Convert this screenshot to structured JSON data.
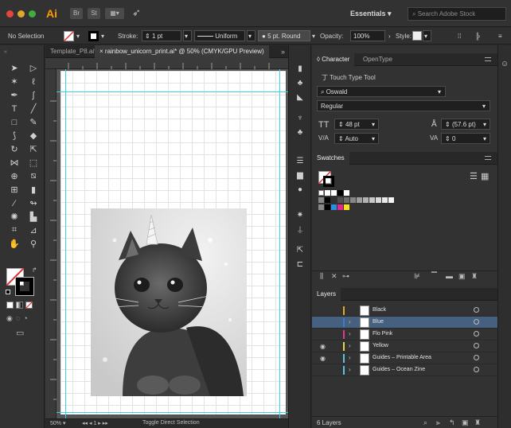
{
  "app": {
    "logo": "Ai",
    "bridge_icon": "Br",
    "stock_icon": "St",
    "workspace": "Essentials",
    "search_placeholder": "Search Adobe Stock"
  },
  "control_bar": {
    "selection": "No Selection",
    "stroke_label": "Stroke:",
    "stroke_value": "1 pt",
    "profile": "Uniform",
    "brush": "5 pt. Round",
    "opacity_label": "Opacity:",
    "opacity_value": "100%",
    "style_label": "Style:"
  },
  "document_tabs": [
    {
      "label": "Template_P8.ai*"
    },
    {
      "label": "rainbow_unicorn_print.ai* @ 50% (CMYK/GPU Preview)"
    }
  ],
  "status": {
    "label": "Toggle Direct Selection"
  },
  "character_panel": {
    "tab_character": "Character",
    "tab_opentype": "OpenType",
    "touch_type": "Touch Type Tool",
    "font_family": "Oswald",
    "font_style": "Regular",
    "font_size": "48 pt",
    "leading": "(57.6 pt)",
    "kerning": "Auto",
    "tracking": "0"
  },
  "swatches_panel": {
    "title": "Swatches"
  },
  "layers_panel": {
    "title": "Layers",
    "count": "6 Layers",
    "layers": [
      {
        "name": "Black",
        "color": "#e0a82e",
        "selected": false,
        "visible": false
      },
      {
        "name": "Blue",
        "color": "#3d7bd6",
        "selected": true,
        "visible": false
      },
      {
        "name": "Flo Pink",
        "color": "#e33b8c",
        "selected": false,
        "visible": false
      },
      {
        "name": "Yellow",
        "color": "#e6d640",
        "selected": false,
        "visible": true
      },
      {
        "name": "Guides – Printable Area",
        "color": "#54c7e8",
        "selected": false,
        "visible": true
      },
      {
        "name": "Guides – Ocean Zine",
        "color": "#54c7e8",
        "selected": false,
        "visible": false
      }
    ]
  },
  "colors": {
    "ui_dark": "#323232",
    "guide": "#3bd2e8",
    "selection": "#46607f",
    "brand": "#ff9a00"
  }
}
